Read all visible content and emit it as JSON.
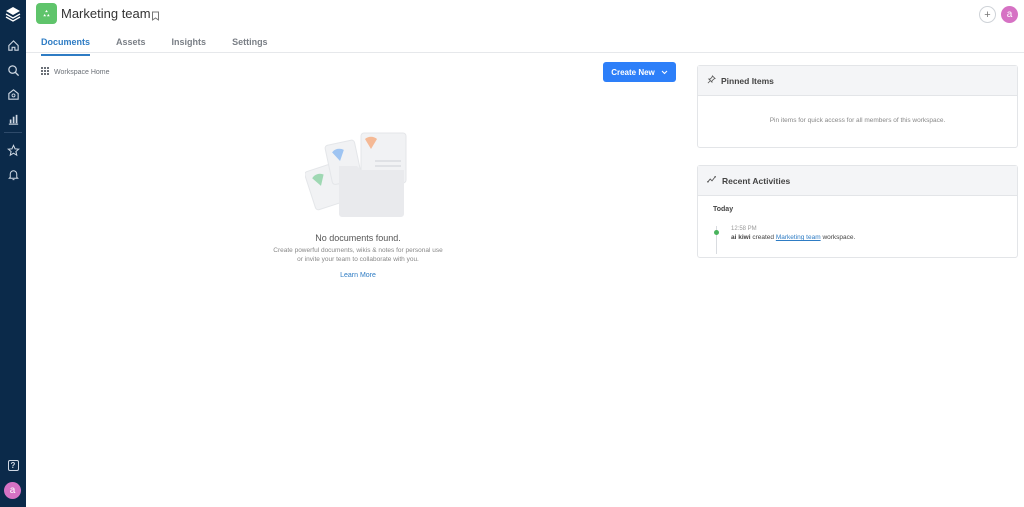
{
  "header": {
    "workspace_title": "Marketing team",
    "tabs": [
      {
        "label": "Documents",
        "active": true
      },
      {
        "label": "Assets",
        "active": false
      },
      {
        "label": "Insights",
        "active": false
      },
      {
        "label": "Settings",
        "active": false
      }
    ],
    "plus_label": "+",
    "avatar_letter": "a"
  },
  "sidebar": {
    "icons": [
      "logo-icon",
      "home-icon",
      "search-icon",
      "team-icon",
      "chart-icon",
      "star-icon",
      "bell-icon",
      "help-icon"
    ],
    "help_label": "?",
    "avatar_letter": "a"
  },
  "main": {
    "breadcrumb": "Workspace Home",
    "create_button": "Create New",
    "empty": {
      "title": "No documents found.",
      "desc_line1": "Create powerful documents, wikis & notes for personal use",
      "desc_line2": "or invite your team to collaborate with you.",
      "link": "Learn More"
    }
  },
  "pinned": {
    "title": "Pinned Items",
    "message": "Pin items for quick access for all members of this workspace."
  },
  "recent": {
    "title": "Recent Activities",
    "group": "Today",
    "activities": [
      {
        "time": "12:58 PM",
        "user": "ai kiwi",
        "verb": "created",
        "target": "Marketing team",
        "suffix": "workspace."
      }
    ]
  },
  "colors": {
    "sidebar_bg": "#0b2a4a",
    "accent": "#2d7ff9",
    "workspace_logo": "#5fc46b",
    "avatar": "#d672c4"
  }
}
